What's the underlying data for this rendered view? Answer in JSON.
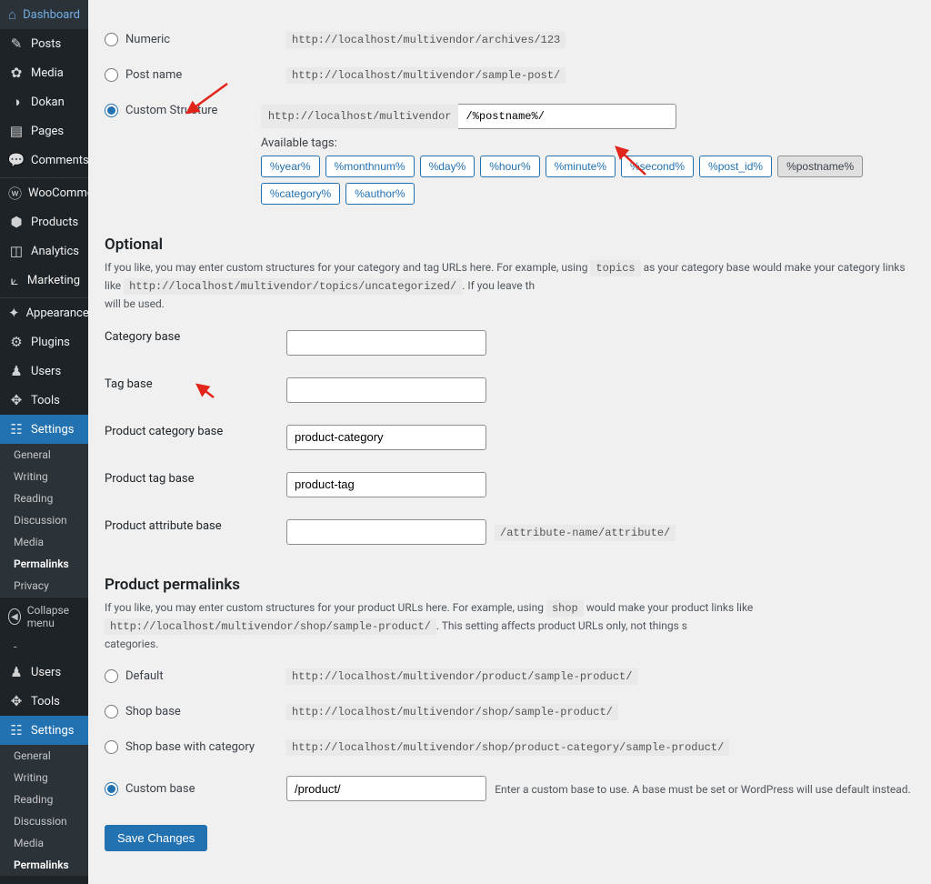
{
  "sidebar": {
    "top": [
      {
        "icon": "⌂",
        "label": "Dashboard",
        "name": "sidebar-item-dashboard"
      },
      {
        "icon": "✎",
        "label": "Posts",
        "name": "sidebar-item-posts"
      },
      {
        "icon": "✿",
        "label": "Media",
        "name": "sidebar-item-media"
      },
      {
        "icon": "◑",
        "label": "Dokan",
        "name": "sidebar-item-dokan"
      },
      {
        "icon": "▤",
        "label": "Pages",
        "name": "sidebar-item-pages"
      },
      {
        "icon": "💬",
        "label": "Comments",
        "name": "sidebar-item-comments"
      }
    ],
    "mid": [
      {
        "icon": "ⓦ",
        "label": "WooCommerce",
        "name": "sidebar-item-woocommerce"
      },
      {
        "icon": "⬢",
        "label": "Products",
        "name": "sidebar-item-products"
      },
      {
        "icon": "◫",
        "label": "Analytics",
        "name": "sidebar-item-analytics"
      },
      {
        "icon": "⟀",
        "label": "Marketing",
        "name": "sidebar-item-marketing"
      }
    ],
    "low": [
      {
        "icon": "✦",
        "label": "Appearance",
        "name": "sidebar-item-appearance"
      },
      {
        "icon": "⚙",
        "label": "Plugins",
        "name": "sidebar-item-plugins"
      },
      {
        "icon": "♟",
        "label": "Users",
        "name": "sidebar-item-users"
      },
      {
        "icon": "✥",
        "label": "Tools",
        "name": "sidebar-item-tools"
      }
    ],
    "settings_label": "Settings",
    "settings_sub": [
      {
        "label": "General",
        "name": "submenu-general"
      },
      {
        "label": "Writing",
        "name": "submenu-writing"
      },
      {
        "label": "Reading",
        "name": "submenu-reading"
      },
      {
        "label": "Discussion",
        "name": "submenu-discussion"
      },
      {
        "label": "Media",
        "name": "submenu-media"
      },
      {
        "label": "Permalinks",
        "name": "submenu-permalinks",
        "current": true
      },
      {
        "label": "Privacy",
        "name": "submenu-privacy"
      }
    ],
    "collapse": "Collapse menu",
    "dup_dash": "-",
    "dup": [
      {
        "icon": "♟",
        "label": "Users",
        "name": "sidebar-item-users-2"
      },
      {
        "icon": "✥",
        "label": "Tools",
        "name": "sidebar-item-tools-2"
      }
    ],
    "settings_sub2": [
      {
        "label": "General",
        "name": "submenu2-general"
      },
      {
        "label": "Writing",
        "name": "submenu2-writing"
      },
      {
        "label": "Reading",
        "name": "submenu2-reading"
      },
      {
        "label": "Discussion",
        "name": "submenu2-discussion"
      },
      {
        "label": "Media",
        "name": "submenu2-media"
      },
      {
        "label": "Permalinks",
        "name": "submenu2-permalinks",
        "current": true
      }
    ]
  },
  "permalink": {
    "numeric": {
      "label": "Numeric",
      "example": "http://localhost/multivendor/archives/123"
    },
    "postname": {
      "label": "Post name",
      "example": "http://localhost/multivendor/sample-post/"
    },
    "custom": {
      "label": "Custom Structure",
      "prefix": "http://localhost/multivendor",
      "value": "/%postname%/",
      "available": "Available tags:"
    },
    "tags": [
      "%year%",
      "%monthnum%",
      "%day%",
      "%hour%",
      "%minute%",
      "%second%",
      "%post_id%",
      "%postname%",
      "%category%",
      "%author%"
    ]
  },
  "optional": {
    "heading": "Optional",
    "desc_a": "If you like, you may enter custom structures for your category and tag URLs here. For example, using ",
    "desc_code_topics": "topics",
    "desc_b": " as your category base would make your category links like ",
    "desc_code_url": "http://localhost/multivendor/topics/uncategorized/",
    "desc_c": ". If you leave th",
    "desc_d": "will be used.",
    "cat_base": "Category base",
    "tag_base": "Tag base",
    "prod_cat_base": "Product category base",
    "prod_cat_val": "product-category",
    "prod_tag_base": "Product tag base",
    "prod_tag_val": "product-tag",
    "prod_attr_base": "Product attribute base",
    "prod_attr_suffix": "/attribute-name/attribute/"
  },
  "product": {
    "heading": "Product permalinks",
    "desc_a": "If you like, you may enter custom structures for your product URLs here. For example, using ",
    "desc_code_shop": "shop",
    "desc_b": " would make your product links like ",
    "desc_code_url": "http://localhost/multivendor/shop/sample-product/",
    "desc_c": ". This setting affects product URLs only, not things s",
    "desc_d": "categories.",
    "default": {
      "label": "Default",
      "example": "http://localhost/multivendor/product/sample-product/"
    },
    "shop": {
      "label": "Shop base",
      "example": "http://localhost/multivendor/shop/sample-product/"
    },
    "shopcat": {
      "label": "Shop base with category",
      "example": "http://localhost/multivendor/shop/product-category/sample-product/"
    },
    "custom": {
      "label": "Custom base",
      "value": "/product/",
      "help": "Enter a custom base to use. A base must be set or WordPress will use default instead."
    }
  },
  "save": "Save Changes"
}
